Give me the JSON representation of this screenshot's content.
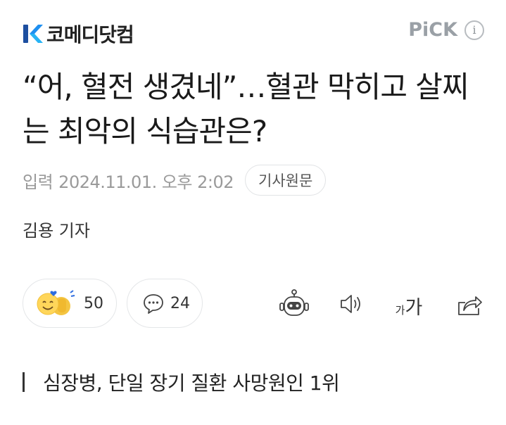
{
  "header": {
    "brand_name": "코메디닷컴",
    "pick_label": "PiCK",
    "info_symbol": "i"
  },
  "article": {
    "headline": "“어, 혈전 생겼네”…혈관 막히고 살찌는 최악의 식습관은?",
    "published_label": "입력",
    "published_date": "2024.11.01. 오후 2:02",
    "source_button": "기사원문",
    "reporter": "김용 기자",
    "subheading": "심장병, 단일 장기 질환 사망원인 1위"
  },
  "actions": {
    "reaction_count": "50",
    "comment_count": "24",
    "font_small": "가",
    "font_large": "가"
  },
  "colors": {
    "brand_blue": "#1e8ff0",
    "brand_navy": "#1d4fa0",
    "pick_gray": "#9aa0a6"
  }
}
